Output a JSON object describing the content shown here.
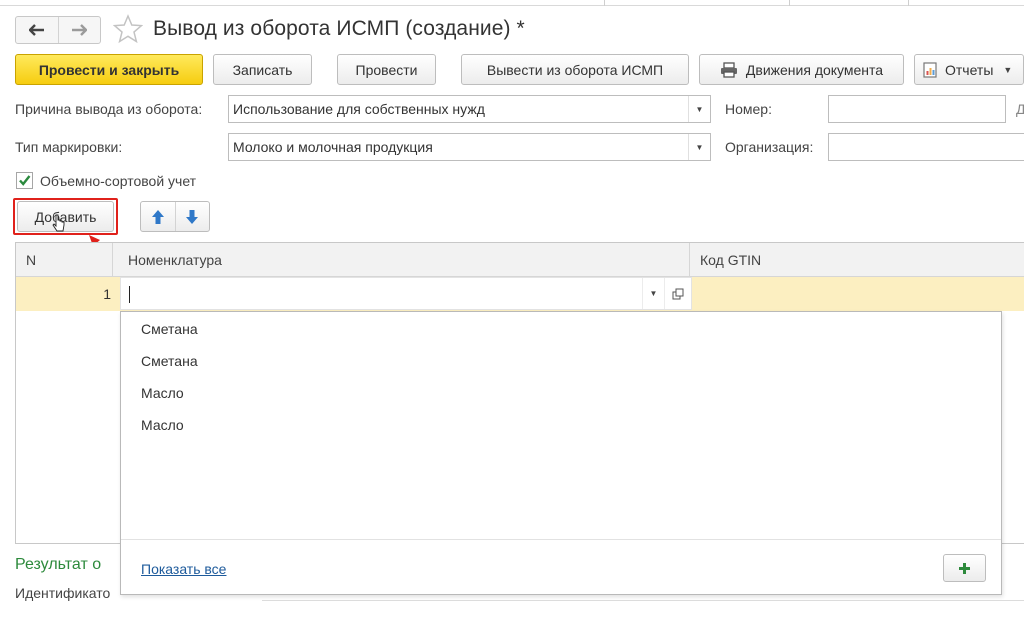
{
  "window": {
    "title": "Вывод из оборота ИСМП (создание) *"
  },
  "navigation": {
    "back_icon": "arrow-left-icon",
    "forward_icon": "arrow-right-icon",
    "favorite_icon": "star-outline-icon"
  },
  "toolbar": {
    "post_close_label": "Провести и закрыть",
    "save_label": "Записать",
    "post_label": "Провести",
    "withdraw_label": "Вывести из оборота ИСМП",
    "movements_label": "Движения документа",
    "reports_label": "Отчеты"
  },
  "form": {
    "reason_label": "Причина вывода из оборота:",
    "reason_value": "Использование для собственных нужд",
    "number_label": "Номер:",
    "number_value": "",
    "number_suffix": "Д",
    "marking_label": "Тип маркировки:",
    "marking_value": "Молоко и молочная продукция",
    "org_label": "Организация:",
    "org_value": "",
    "volume_sort_label": "Объемно-сортовой учет",
    "volume_sort_checked": true
  },
  "table_toolbar": {
    "add_label": "Добавить",
    "move_up_icon": "arrow-up-icon",
    "move_down_icon": "arrow-down-icon"
  },
  "table": {
    "columns": [
      "N",
      "Номенклатура",
      "Код GTIN"
    ],
    "rows": [
      {
        "n": "1",
        "nomenclature": "",
        "gtin": ""
      }
    ]
  },
  "dropdown": {
    "items": [
      "Сметана",
      "Сметана",
      "Масло",
      "Масло"
    ],
    "show_all_label": "Показать все"
  },
  "footer": {
    "result_label": "Результат о",
    "identifier_label": "Идентификато"
  },
  "colors": {
    "primary_button": "#f6cd10",
    "selected_row": "#fcefc1",
    "highlight_box": "#e0211b",
    "result_heading": "#2d8a3c",
    "link": "#1d5a9b"
  }
}
